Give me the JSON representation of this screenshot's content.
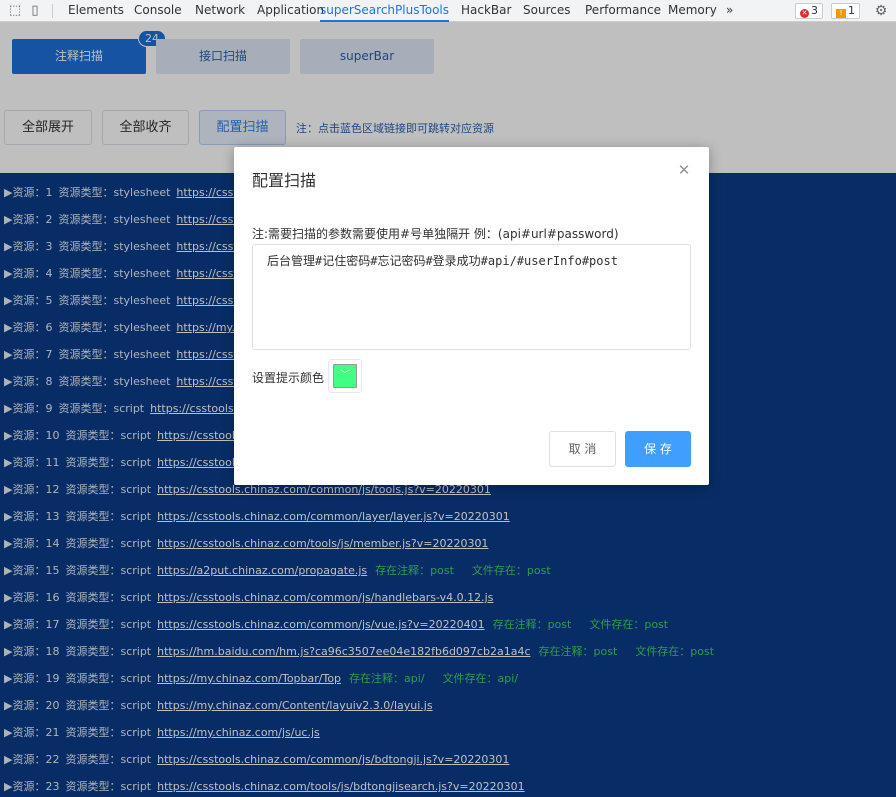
{
  "devtools": {
    "tabs": [
      "Elements",
      "Console",
      "Network",
      "Application",
      "superSearchPlusTools",
      "HackBar",
      "Sources",
      "Performance",
      "Memory"
    ],
    "more": "»",
    "errors": "3",
    "warnings": "1",
    "accent": "#1a73e8"
  },
  "main_tabs": {
    "comment_scan": "注释扫描",
    "comment_count": "24",
    "api_scan": "接口扫描",
    "superbar": "superBar"
  },
  "toolbar": {
    "expand_all": "全部展开",
    "collapse_all": "全部收齐",
    "config_scan": "配置扫描",
    "note": "注：点击蓝色区域链接即可跳转对应资源"
  },
  "resources": [
    {
      "prefix": "▶资源：1",
      "type": "资源类型：stylesheet",
      "url": "https://cssto",
      "hits": []
    },
    {
      "prefix": "▶资源：2",
      "type": "资源类型：stylesheet",
      "url": "https://cssto",
      "hits": []
    },
    {
      "prefix": "▶资源：3",
      "type": "资源类型：stylesheet",
      "url": "https://cssto",
      "hits": []
    },
    {
      "prefix": "▶资源：4",
      "type": "资源类型：stylesheet",
      "url": "https://cssto",
      "hits": []
    },
    {
      "prefix": "▶资源：5",
      "type": "资源类型：stylesheet",
      "url": "https://cssto",
      "hits": []
    },
    {
      "prefix": "▶资源：6",
      "type": "资源类型：stylesheet",
      "url": "https://my.c",
      "hits": []
    },
    {
      "prefix": "▶资源：7",
      "type": "资源类型：stylesheet",
      "url": "https://cssto",
      "hits": []
    },
    {
      "prefix": "▶资源：8",
      "type": "资源类型：stylesheet",
      "url": "https://cssto",
      "hits": []
    },
    {
      "prefix": "▶资源：9",
      "type": "资源类型：script",
      "url": "https://csstools.",
      "hits": []
    },
    {
      "prefix": "▶资源：10",
      "type": "资源类型：script",
      "url": "https://csstools",
      "hits": []
    },
    {
      "prefix": "▶资源：11",
      "type": "资源类型：script",
      "url": "https://csstools",
      "hits": []
    },
    {
      "prefix": "▶资源：12",
      "type": "资源类型：script",
      "url": "https://csstools.chinaz.com/common/js/tools.js?v=20220301",
      "hits": []
    },
    {
      "prefix": "▶资源：13",
      "type": "资源类型：script",
      "url": "https://csstools.chinaz.com/common/layer/layer.js?v=20220301",
      "hits": []
    },
    {
      "prefix": "▶资源：14",
      "type": "资源类型：script",
      "url": "https://csstools.chinaz.com/tools/js/member.js?v=20220301",
      "hits": []
    },
    {
      "prefix": "▶资源：15",
      "type": "资源类型：script",
      "url": "https://a2put.chinaz.com/propagate.js",
      "hits": [
        "存在注释：post",
        "文件存在：post"
      ]
    },
    {
      "prefix": "▶资源：16",
      "type": "资源类型：script",
      "url": "https://csstools.chinaz.com/common/js/handlebars-v4.0.12.js",
      "hits": []
    },
    {
      "prefix": "▶资源：17",
      "type": "资源类型：script",
      "url": "https://csstools.chinaz.com/common/js/vue.js?v=20220401",
      "hits": [
        "存在注释：post",
        "文件存在：post"
      ]
    },
    {
      "prefix": "▶资源：18",
      "type": "资源类型：script",
      "url": "https://hm.baidu.com/hm.js?ca96c3507ee04e182fb6d097cb2a1a4c",
      "hits": [
        "存在注释：post",
        "文件存在：post"
      ]
    },
    {
      "prefix": "▶资源：19",
      "type": "资源类型：script",
      "url": "https://my.chinaz.com/Topbar/Top",
      "hits": [
        "存在注释：api/",
        "文件存在：api/"
      ]
    },
    {
      "prefix": "▶资源：20",
      "type": "资源类型：script",
      "url": "https://my.chinaz.com/Content/layuiv2.3.0/layui.js",
      "hits": []
    },
    {
      "prefix": "▶资源：21",
      "type": "资源类型：script",
      "url": "https://my.chinaz.com/js/uc.js",
      "hits": []
    },
    {
      "prefix": "▶资源：22",
      "type": "资源类型：script",
      "url": "https://csstools.chinaz.com/common/js/bdtongji.js?v=20220301",
      "hits": []
    },
    {
      "prefix": "▶资源：23",
      "type": "资源类型：script",
      "url": "https://csstools.chinaz.com/tools/js/bdtongjisearch.js?v=20220301",
      "hits": []
    }
  ],
  "dialog": {
    "title": "配置扫描",
    "hint": "注:需要扫描的参数需要使用#号单独隔开 例：(api#url#password)",
    "keywords": "后台管理#记住密码#忘记密码#登录成功#api/#userInfo#post",
    "color_label": "设置提示颜色",
    "color_value": "#41ff83",
    "cancel": "取 消",
    "save": "保 存",
    "primary_color": "#409eff"
  },
  "colors": {
    "list_bg": "#0b3c88",
    "hit_text": "#3fcf68",
    "active_tab": "#1e6fd9"
  }
}
